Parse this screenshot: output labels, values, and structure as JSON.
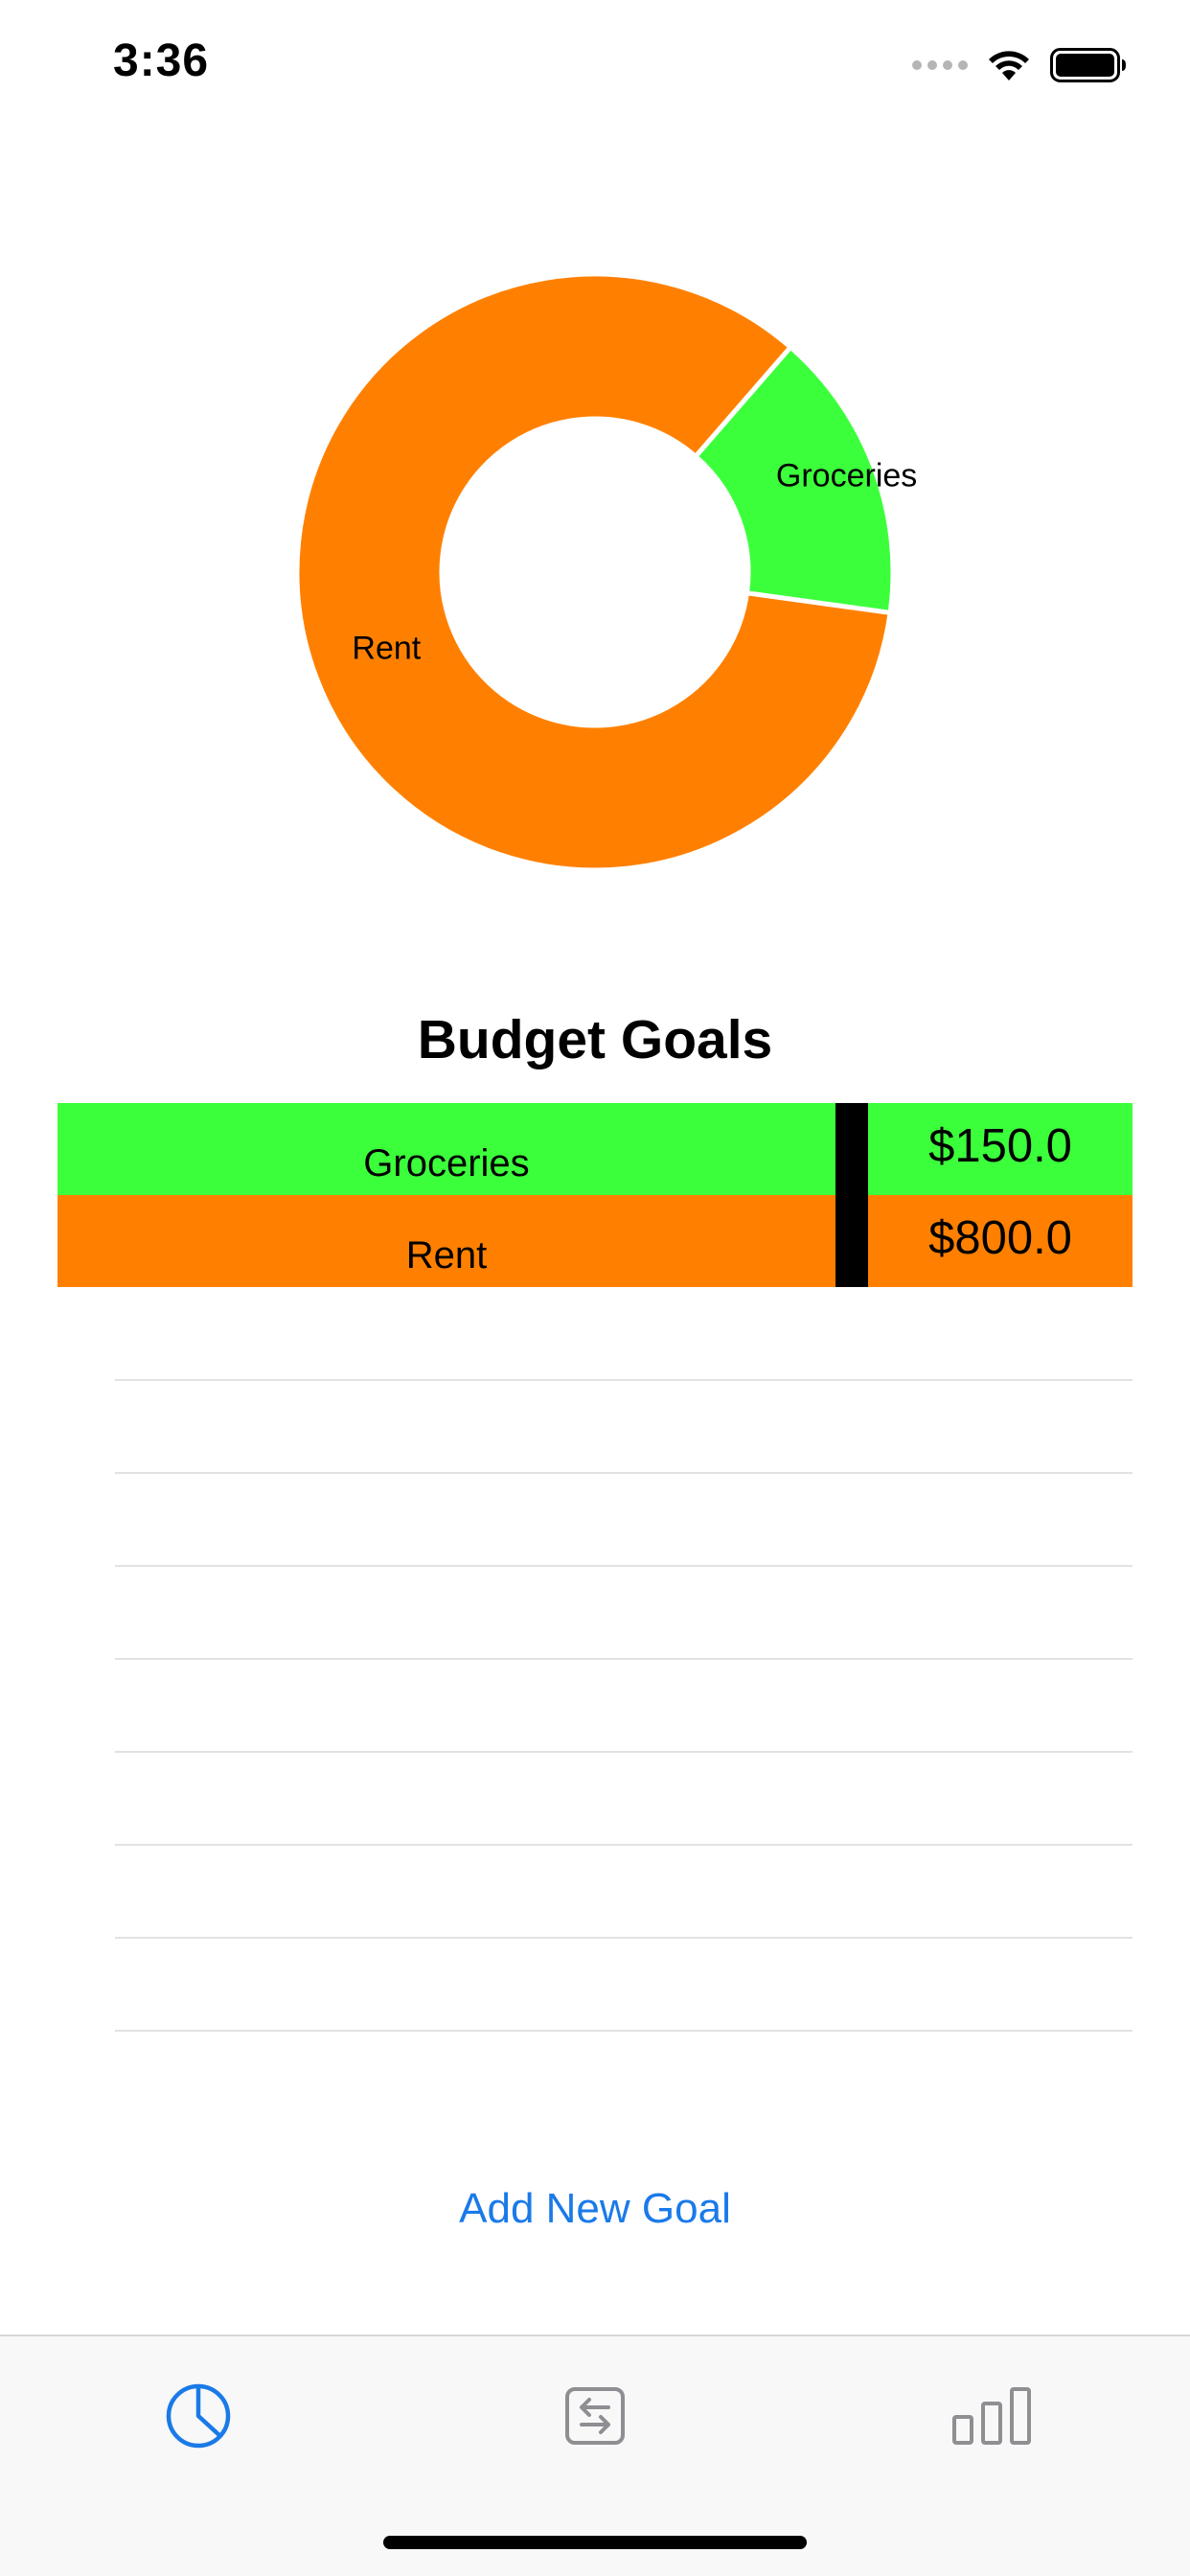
{
  "status_bar": {
    "time": "3:36"
  },
  "chart_data": {
    "type": "pie",
    "slices": [
      {
        "label": "Groceries",
        "value": 150.0,
        "color": "#3cff3c"
      },
      {
        "label": "Rent",
        "value": 800.0,
        "color": "#ff8000"
      }
    ]
  },
  "budget": {
    "title": "Budget Goals",
    "goals": [
      {
        "name": "Groceries",
        "amount": "$150.0",
        "color": "#3cff3c"
      },
      {
        "name": "Rent",
        "amount": "$800.0",
        "color": "#ff8000"
      }
    ],
    "add_button": "Add New Goal"
  },
  "tab_bar": {
    "items": [
      {
        "icon": "pie-chart-icon",
        "active": true,
        "color": "#1a7ae8"
      },
      {
        "icon": "transfer-icon",
        "active": false,
        "color": "#8e8e93"
      },
      {
        "icon": "bar-chart-icon",
        "active": false,
        "color": "#8e8e93"
      }
    ]
  }
}
